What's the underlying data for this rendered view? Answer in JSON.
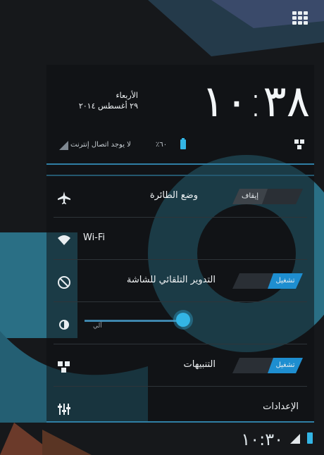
{
  "header": {
    "clock": "١٠:٣٨",
    "day": "الأربعاء",
    "date": "٢٩ أغسطس ٢٠١٤"
  },
  "status": {
    "battery": "٦٠٪",
    "signal": "لا يوجد اتصال إنترنت"
  },
  "quick_settings": {
    "airplane": {
      "label": "وضع الطائرة",
      "toggle": "إيقاف"
    },
    "wifi": {
      "label": "Wi-Fi"
    },
    "auto_rotate": {
      "label": "التدوير التلقائي للشاشة",
      "toggle": "تشغيل"
    },
    "brightness": {
      "auto": "آلي",
      "level": 0.6
    },
    "notifications": {
      "label": "التنبيهات",
      "toggle": "تشغيل"
    },
    "settings": {
      "label": "الإعدادات"
    }
  },
  "statusbar": {
    "time": "١٠:٣٠"
  },
  "colors": {
    "accent": "#33b5e5",
    "background": "#16181b",
    "wallpaper_teal": "#2a6f85"
  },
  "icons": [
    "apps-grid-icon",
    "quick-settings-icon",
    "airplane-icon",
    "wifi-icon",
    "rotate-icon",
    "brightness-icon",
    "notifications-icon",
    "settings-icon",
    "signal-icon",
    "battery-icon"
  ]
}
